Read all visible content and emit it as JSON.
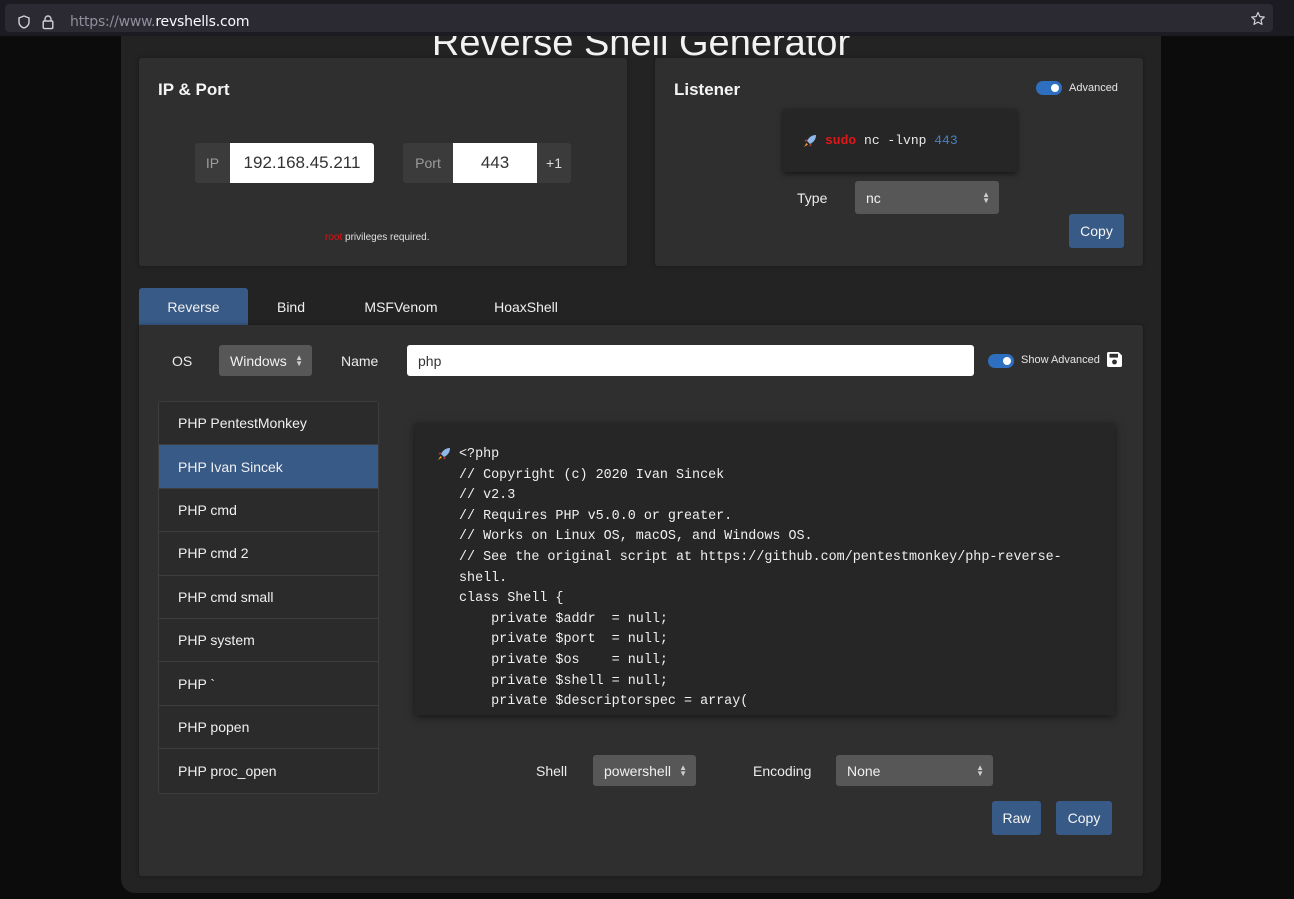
{
  "browser": {
    "url_scheme": "https://www.",
    "url_host": "revshells.com",
    "icons": [
      "shield-icon",
      "lock-icon",
      "bookmark-star-icon"
    ]
  },
  "page": {
    "title": "Reverse Shell Generator"
  },
  "ip_port": {
    "title": "IP & Port",
    "ip_label": "IP",
    "ip_value": "192.168.45.211",
    "port_label": "Port",
    "port_value": "443",
    "increment_label": "+1",
    "note_root": "root",
    "note_rest": " privileges required."
  },
  "listener": {
    "title": "Listener",
    "advanced_label": "Advanced",
    "advanced_on": true,
    "cmd_sudo": "sudo",
    "cmd_text": " nc -lvnp ",
    "cmd_port": "443",
    "type_label": "Type",
    "type_value": "nc",
    "copy_label": "Copy"
  },
  "tabs": [
    {
      "label": "Reverse",
      "active": true
    },
    {
      "label": "Bind",
      "active": false
    },
    {
      "label": "MSFVenom",
      "active": false
    },
    {
      "label": "HoaxShell",
      "active": false
    }
  ],
  "filters": {
    "os_label": "OS",
    "os_value": "Windows",
    "name_label": "Name",
    "name_value": "php",
    "show_advanced_label": "Show Advanced",
    "show_advanced_on": true,
    "save_icon": "floppy-disk-icon"
  },
  "shell_list": [
    {
      "label": "PHP PentestMonkey",
      "active": false
    },
    {
      "label": "PHP Ivan Sincek",
      "active": true
    },
    {
      "label": "PHP cmd",
      "active": false
    },
    {
      "label": "PHP cmd 2",
      "active": false
    },
    {
      "label": "PHP cmd small",
      "active": false
    },
    {
      "label": "PHP system",
      "active": false
    },
    {
      "label": "PHP `",
      "active": false
    },
    {
      "label": "PHP popen",
      "active": false
    },
    {
      "label": "PHP proc_open",
      "active": false
    }
  ],
  "code": {
    "text": "<?php\n// Copyright (c) 2020 Ivan Sincek\n// v2.3\n// Requires PHP v5.0.0 or greater.\n// Works on Linux OS, macOS, and Windows OS.\n// See the original script at https://github.com/pentestmonkey/php-reverse-\nshell.\nclass Shell {\n    private $addr  = null;\n    private $port  = null;\n    private $os    = null;\n    private $shell = null;\n    private $descriptorspec = array("
  },
  "bottom": {
    "shell_label": "Shell",
    "shell_value": "powershell",
    "encoding_label": "Encoding",
    "encoding_value": "None",
    "raw_label": "Raw",
    "copy_label": "Copy"
  },
  "colors": {
    "accent": "#375a87",
    "sudo_red": "#e01818",
    "port_blue": "#4a7fc2",
    "card_bg": "#2f2f2f"
  }
}
